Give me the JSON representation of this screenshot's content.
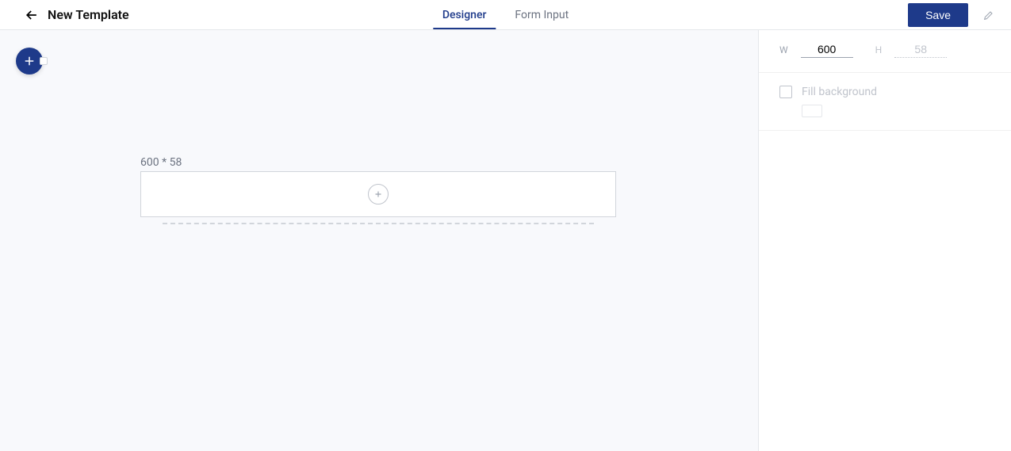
{
  "header": {
    "title": "New Template",
    "tabs": [
      {
        "label": "Designer",
        "active": true
      },
      {
        "label": "Form Input",
        "active": false
      }
    ],
    "save_label": "Save"
  },
  "canvas": {
    "dim_label": "600 * 58"
  },
  "panel": {
    "width": {
      "label": "W",
      "value": "600"
    },
    "height": {
      "label": "H",
      "value": "58"
    },
    "fill_label": "Fill background",
    "fill_checked": false
  }
}
